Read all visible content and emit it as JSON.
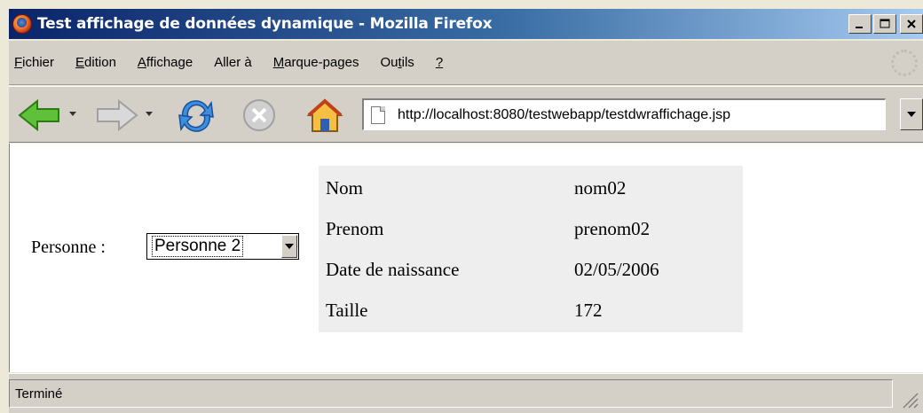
{
  "window": {
    "title": "Test affichage de données dynamique - Mozilla Firefox",
    "buttons": {
      "minimize": "_",
      "maximize": "□",
      "close": "×"
    }
  },
  "menu": {
    "items": [
      {
        "label": "Fichier"
      },
      {
        "label": "Edition"
      },
      {
        "label": "Affichage"
      },
      {
        "label": "Aller à"
      },
      {
        "label": "Marque-pages"
      },
      {
        "label": "Outils"
      },
      {
        "label": "?"
      }
    ]
  },
  "toolbar": {
    "icons": [
      "back-icon",
      "forward-icon",
      "reload-icon",
      "stop-icon",
      "home-icon"
    ],
    "url": "http://localhost:8080/testwebapp/testdwraffichage.jsp"
  },
  "page": {
    "person_label": "Personne :",
    "select_value": "Personne 2",
    "rows": [
      {
        "label": "Nom",
        "value": "nom02"
      },
      {
        "label": "Prenom",
        "value": "prenom02"
      },
      {
        "label": "Date de naissance",
        "value": "02/05/2006"
      },
      {
        "label": "Taille",
        "value": "172"
      }
    ]
  },
  "status": {
    "text": "Terminé"
  },
  "colors": {
    "title_start": "#0a246a",
    "title_end": "#a6caf0",
    "table_bg": "#eeeeee",
    "chrome": "#d4d0c8"
  }
}
